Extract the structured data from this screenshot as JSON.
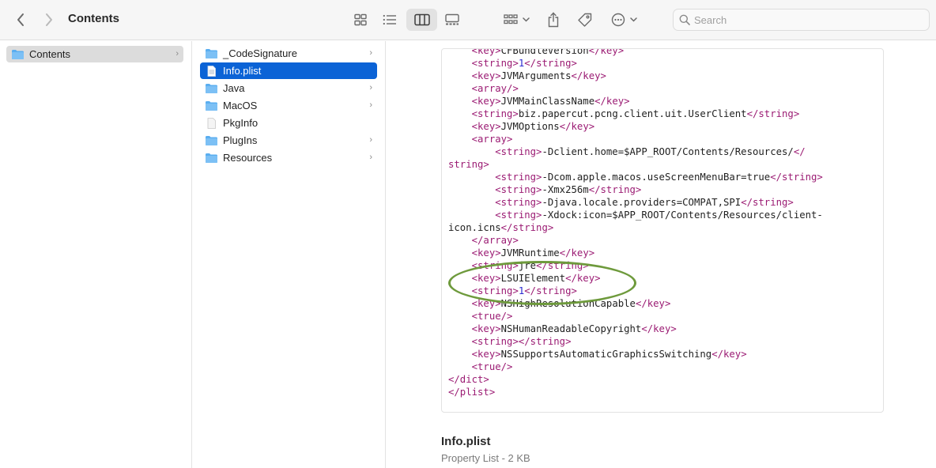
{
  "window": {
    "title": "Contents"
  },
  "toolbar": {
    "back_icon": "chevron-left-icon",
    "forward_icon": "chevron-right-icon",
    "views": [
      "icon-view-icon",
      "list-view-icon",
      "column-view-icon",
      "gallery-view-icon"
    ],
    "active_view": "column-view-icon",
    "group_icon": "group-by-icon",
    "share_icon": "share-icon",
    "tag_icon": "tag-icon",
    "more_icon": "ellipsis-circle-icon"
  },
  "search": {
    "placeholder": "Search",
    "value": ""
  },
  "column1": {
    "items": [
      {
        "label": "Contents",
        "type": "folder",
        "selected": true
      }
    ]
  },
  "column2": {
    "items": [
      {
        "label": "_CodeSignature",
        "type": "folder"
      },
      {
        "label": "Info.plist",
        "type": "file",
        "selected": true
      },
      {
        "label": "Java",
        "type": "folder"
      },
      {
        "label": "MacOS",
        "type": "folder"
      },
      {
        "label": "PkgInfo",
        "type": "file"
      },
      {
        "label": "PlugIns",
        "type": "folder"
      },
      {
        "label": "Resources",
        "type": "folder"
      }
    ]
  },
  "preview": {
    "lines": [
      "    <key>CFBundleVersion</key>",
      "    <string>1</string>",
      "    <key>JVMArguments</key>",
      "    <array/>",
      "    <key>JVMMainClassName</key>",
      "    <string>biz.papercut.pcng.client.uit.UserClient</string>",
      "    <key>JVMOptions</key>",
      "    <array>",
      "        <string>-Dclient.home=$APP_ROOT/Contents/Resources/</",
      "string>",
      "        <string>-Dcom.apple.macos.useScreenMenuBar=true</string>",
      "        <string>-Xmx256m</string>",
      "        <string>-Djava.locale.providers=COMPAT,SPI</string>",
      "        <string>-Xdock:icon=$APP_ROOT/Contents/Resources/client-",
      "icon.icns</string>",
      "    </array>",
      "    <key>JVMRuntime</key>",
      "    <string>jre</string>",
      "    <key>LSUIElement</key>",
      "    <string>1</string>",
      "    <key>NSHighResolutionCapable</key>",
      "    <true/>",
      "    <key>NSHumanReadableCopyright</key>",
      "    <string></string>",
      "    <key>NSSupportsAutomaticGraphicsSwitching</key>",
      "    <true/>",
      "</dict>",
      "</plist>"
    ],
    "highlight_color": "#6e9a3c"
  },
  "info": {
    "name": "Info.plist",
    "kind": "Property List - 2 KB"
  },
  "colors": {
    "selection_blue": "#0b63d6",
    "folder_blue": "#5aaef0",
    "xml_tag": "#9b1b73",
    "xml_number": "#2b2bd0"
  }
}
